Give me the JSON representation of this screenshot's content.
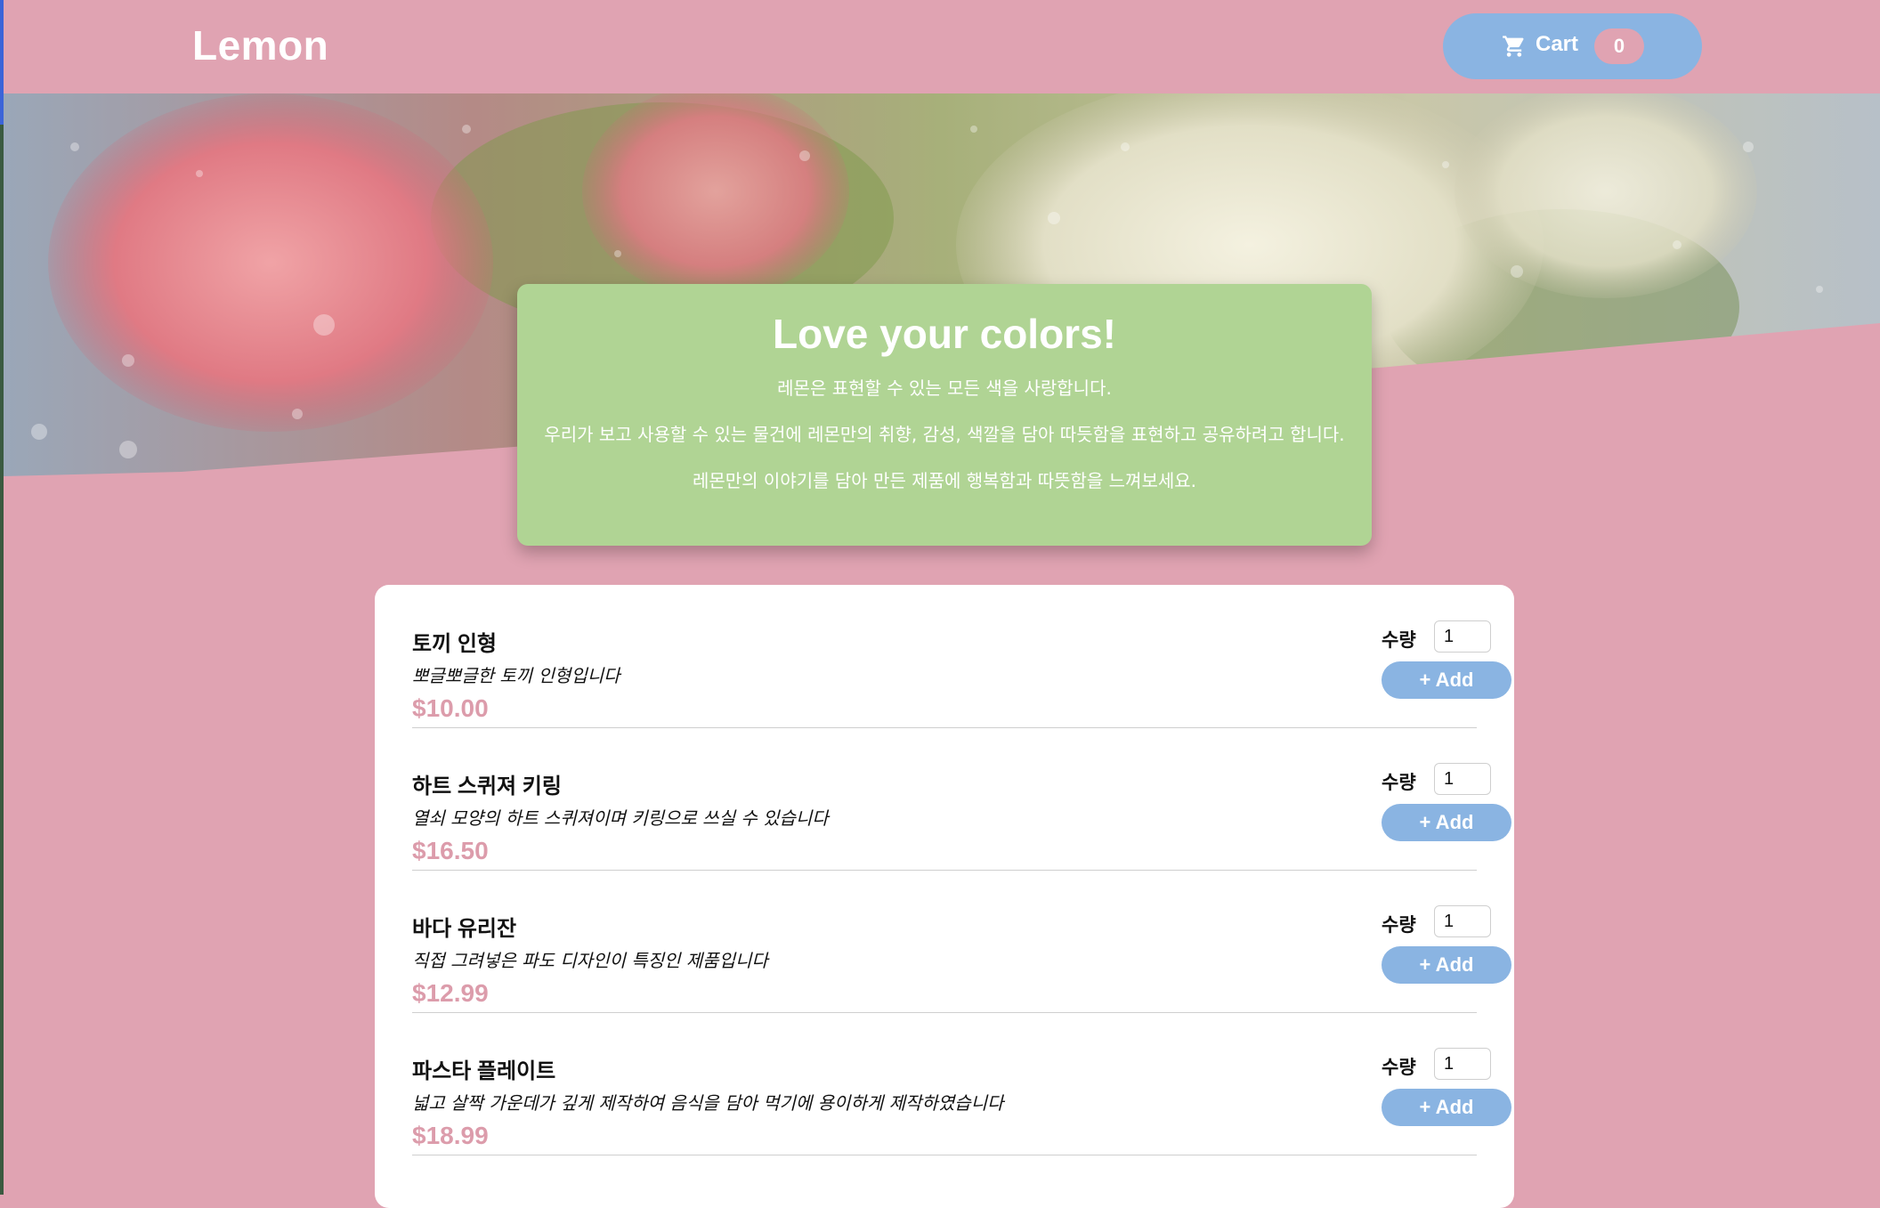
{
  "header": {
    "brand": "Lemon",
    "cart": {
      "icon": "shopping-cart-icon",
      "label": "Cart",
      "count": "0"
    }
  },
  "hero": {
    "image": "rain-covered glass with pink and white flowers"
  },
  "intro": {
    "title": "Love your colors!",
    "lines": [
      "레몬은 표현할 수 있는 모든 색을 사랑합니다.",
      "우리가 보고 사용할 수 있는 물건에 레몬만의 취향, 감성, 색깔을 담아 따듯함을 표현하고 공유하려고 합니다.",
      "레몬만의 이야기를 담아 만든 제품에 행복함과 따뜻함을 느껴보세요."
    ]
  },
  "products": [
    {
      "name": "토끼 인형",
      "description": "뽀글뽀글한 토끼 인형입니다",
      "price": "$10.00",
      "qty_label": "수량",
      "qty": "1",
      "add_label": "+ Add"
    },
    {
      "name": "하트 스퀴져 키링",
      "description": "열쇠 모양의 하트 스퀴져이며 키링으로 쓰실 수 있습니다",
      "price": "$16.50",
      "qty_label": "수량",
      "qty": "1",
      "add_label": "+ Add"
    },
    {
      "name": "바다 유리잔",
      "description": "직접 그려넣은 파도 디자인이 특징인 제품입니다",
      "price": "$12.99",
      "qty_label": "수량",
      "qty": "1",
      "add_label": "+ Add"
    },
    {
      "name": "파스타 플레이트",
      "description": "넓고 살짝 가운데가 깊게 제작하여 음식을 담아 먹기에 용이하게 제작하였습니다",
      "price": "$18.99",
      "qty_label": "수량",
      "qty": "1",
      "add_label": "+ Add"
    }
  ],
  "colors": {
    "page_background": "#e0a3b2",
    "accent_blue": "#8ab4e2",
    "intro_green": "#b0d494",
    "price_pink": "#dc9cab"
  }
}
